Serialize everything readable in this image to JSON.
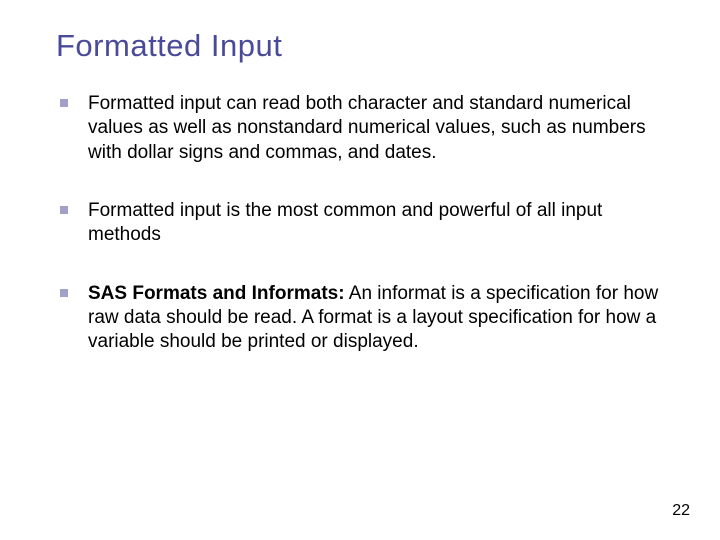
{
  "title": "Formatted Input",
  "bullets": [
    {
      "text": "Formatted input can read both character and standard numerical values as well as nonstandard numerical values, such as numbers with dollar signs and commas, and dates."
    },
    {
      "text": "Formatted input is the most common and powerful of all input methods"
    },
    {
      "boldPrefix": "SAS Formats and Informats:",
      "text": " An informat is a specification for how raw data should be read. A format is a layout specification for how a variable should be printed or displayed."
    }
  ],
  "pageNumber": "22"
}
